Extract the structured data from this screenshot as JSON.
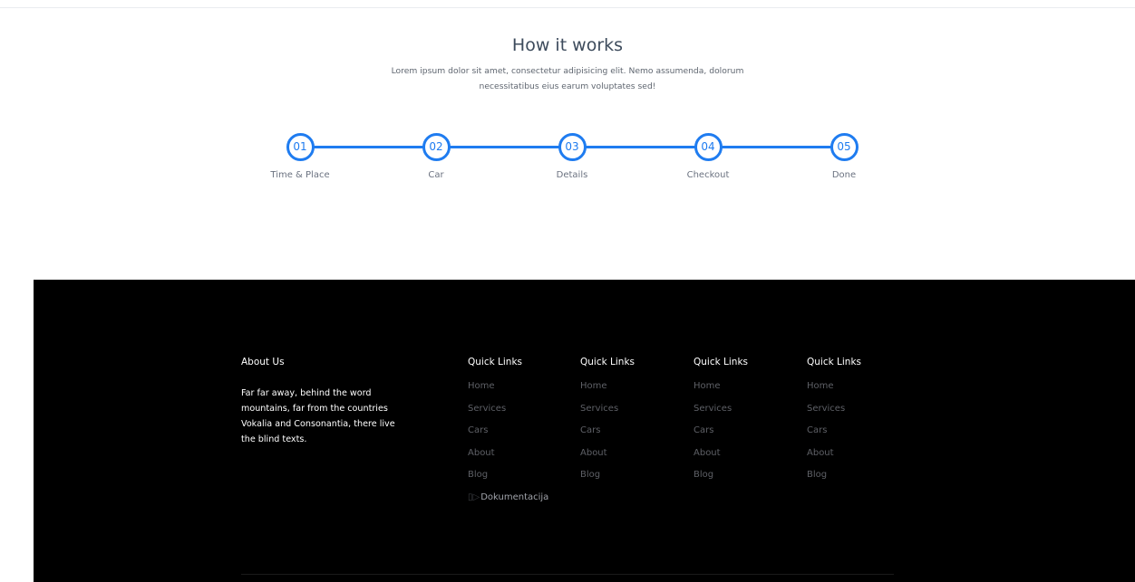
{
  "how_it_works": {
    "title": "How it works",
    "subtitle": "Lorem ipsum dolor sit amet, consectetur adipisicing elit. Nemo assumenda, dolorum necessitatibus eius earum voluptates sed!",
    "steps": [
      {
        "number": "01",
        "label": "Time & Place"
      },
      {
        "number": "02",
        "label": "Car"
      },
      {
        "number": "03",
        "label": "Details"
      },
      {
        "number": "04",
        "label": "Checkout"
      },
      {
        "number": "05",
        "label": "Done"
      }
    ],
    "accent_color": "#1f7cf0"
  },
  "footer": {
    "about": {
      "heading": "About Us",
      "text": "Far far away, behind the word mountains, far from the countries Vokalia and Consonantia, there live the blind texts."
    },
    "quick_links": [
      {
        "heading": "Quick Links",
        "links": [
          "Home",
          "Services",
          "Cars",
          "About",
          "Blog"
        ],
        "extra_link": "Dokumentacija",
        "extra_icon": "broken-image-icon"
      },
      {
        "heading": "Quick Links",
        "links": [
          "Home",
          "Services",
          "Cars",
          "About",
          "Blog"
        ]
      },
      {
        "heading": "Quick Links",
        "links": [
          "Home",
          "Services",
          "Cars",
          "About",
          "Blog"
        ]
      },
      {
        "heading": "Quick Links",
        "links": [
          "Home",
          "Services",
          "Cars",
          "About",
          "Blog"
        ]
      }
    ]
  }
}
